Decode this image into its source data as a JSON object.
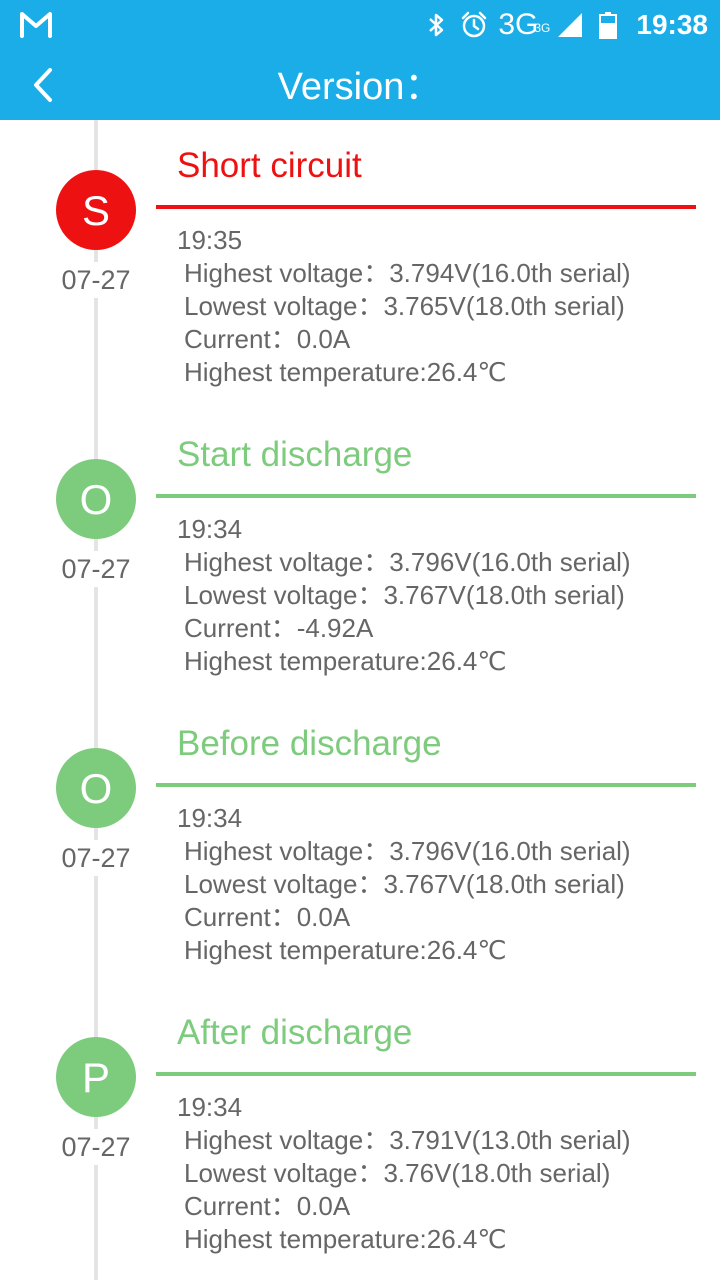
{
  "status_bar": {
    "app_icon": "gmail-icon",
    "icons": [
      "bluetooth-icon",
      "alarm-icon",
      "signal-icon",
      "battery-icon"
    ],
    "network": "3G",
    "network_sup": "3G",
    "time": "19:38"
  },
  "header": {
    "back_icon": "back-arrow-icon",
    "title": "Version："
  },
  "colors": {
    "accent": "#1aade8",
    "alert": "#ee1111",
    "ok": "#7dcb7d"
  },
  "events": [
    {
      "status": "alert",
      "badge": "S",
      "date": "07-27",
      "title": "Short circuit",
      "time": "19:35",
      "highest_voltage": "Highest voltage：3.794V(16.0th serial)",
      "lowest_voltage": "Lowest voltage：3.765V(18.0th serial)",
      "current": "Current：0.0A",
      "highest_temperature": "Highest temperature:26.4℃"
    },
    {
      "status": "ok",
      "badge": "O",
      "date": "07-27",
      "title": "Start discharge",
      "time": "19:34",
      "highest_voltage": "Highest voltage：3.796V(16.0th serial)",
      "lowest_voltage": "Lowest voltage：3.767V(18.0th serial)",
      "current": "Current：-4.92A",
      "highest_temperature": "Highest temperature:26.4℃"
    },
    {
      "status": "ok",
      "badge": "O",
      "date": "07-27",
      "title": "Before discharge",
      "time": "19:34",
      "highest_voltage": "Highest voltage：3.796V(16.0th serial)",
      "lowest_voltage": "Lowest voltage：3.767V(18.0th serial)",
      "current": "Current：0.0A",
      "highest_temperature": "Highest temperature:26.4℃"
    },
    {
      "status": "ok",
      "badge": "P",
      "date": "07-27",
      "title": "After discharge",
      "time": "19:34",
      "highest_voltage": "Highest voltage：3.791V(13.0th serial)",
      "lowest_voltage": "Lowest voltage：3.76V(18.0th serial)",
      "current": "Current：0.0A",
      "highest_temperature": "Highest temperature:26.4℃"
    }
  ]
}
